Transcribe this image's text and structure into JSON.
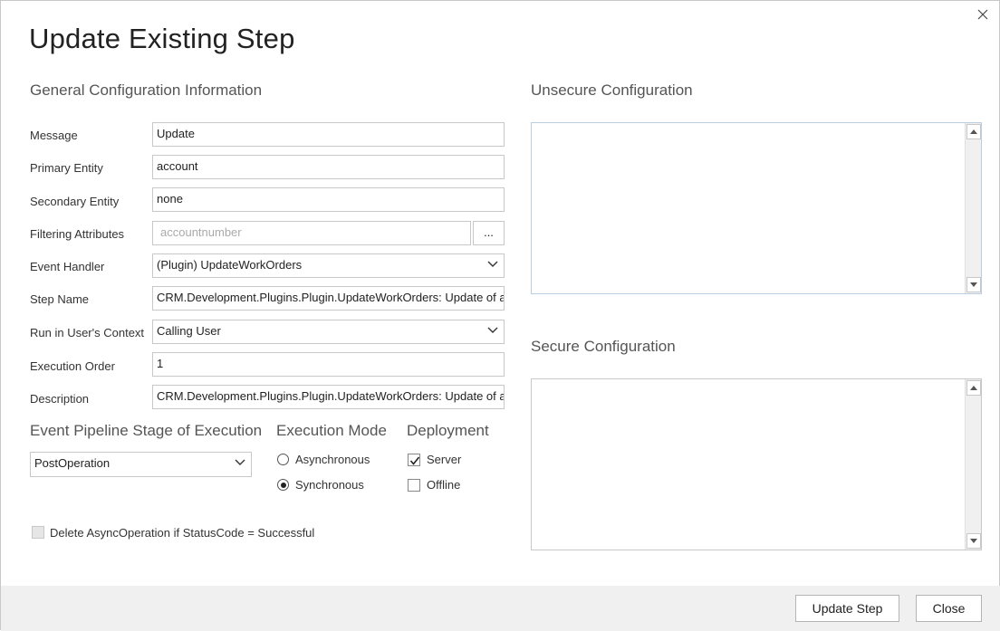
{
  "dialog": {
    "title": "Update Existing Step",
    "close_icon": "close-icon"
  },
  "general": {
    "heading": "General Configuration Information",
    "fields": [
      {
        "label": "Message",
        "value": "Update"
      },
      {
        "label": "Primary Entity",
        "value": "account"
      },
      {
        "label": "Secondary Entity",
        "value": "none"
      },
      {
        "label": "Filtering Attributes",
        "placeholder": "accountnumber",
        "button": "..."
      },
      {
        "label": "Event Handler",
        "value": "(Plugin) UpdateWorkOrders"
      },
      {
        "label": "Step Name",
        "value": "CRM.Development.Plugins.Plugin.UpdateWorkOrders: Update of account"
      },
      {
        "label": "Run in User's Context",
        "value": "Calling User"
      },
      {
        "label": "Execution Order",
        "value": "1"
      },
      {
        "label": "Description",
        "value": "CRM.Development.Plugins.Plugin.UpdateWorkOrders: Update of account"
      }
    ]
  },
  "pipeline": {
    "heading": "Event Pipeline Stage of Execution",
    "value": "PostOperation"
  },
  "execution_mode": {
    "heading": "Execution Mode",
    "options": [
      {
        "label": "Asynchronous",
        "selected": false
      },
      {
        "label": "Synchronous",
        "selected": true
      }
    ]
  },
  "deployment": {
    "heading": "Deployment",
    "options": [
      {
        "label": "Server",
        "checked": true
      },
      {
        "label": "Offline",
        "checked": false
      }
    ]
  },
  "delete_async": {
    "label": "Delete AsyncOperation if StatusCode = Successful",
    "checked": false
  },
  "unsecure": {
    "heading": "Unsecure  Configuration"
  },
  "secure": {
    "heading": "Secure  Configuration"
  },
  "footer": {
    "update_label": "Update Step",
    "close_label": "Close"
  }
}
